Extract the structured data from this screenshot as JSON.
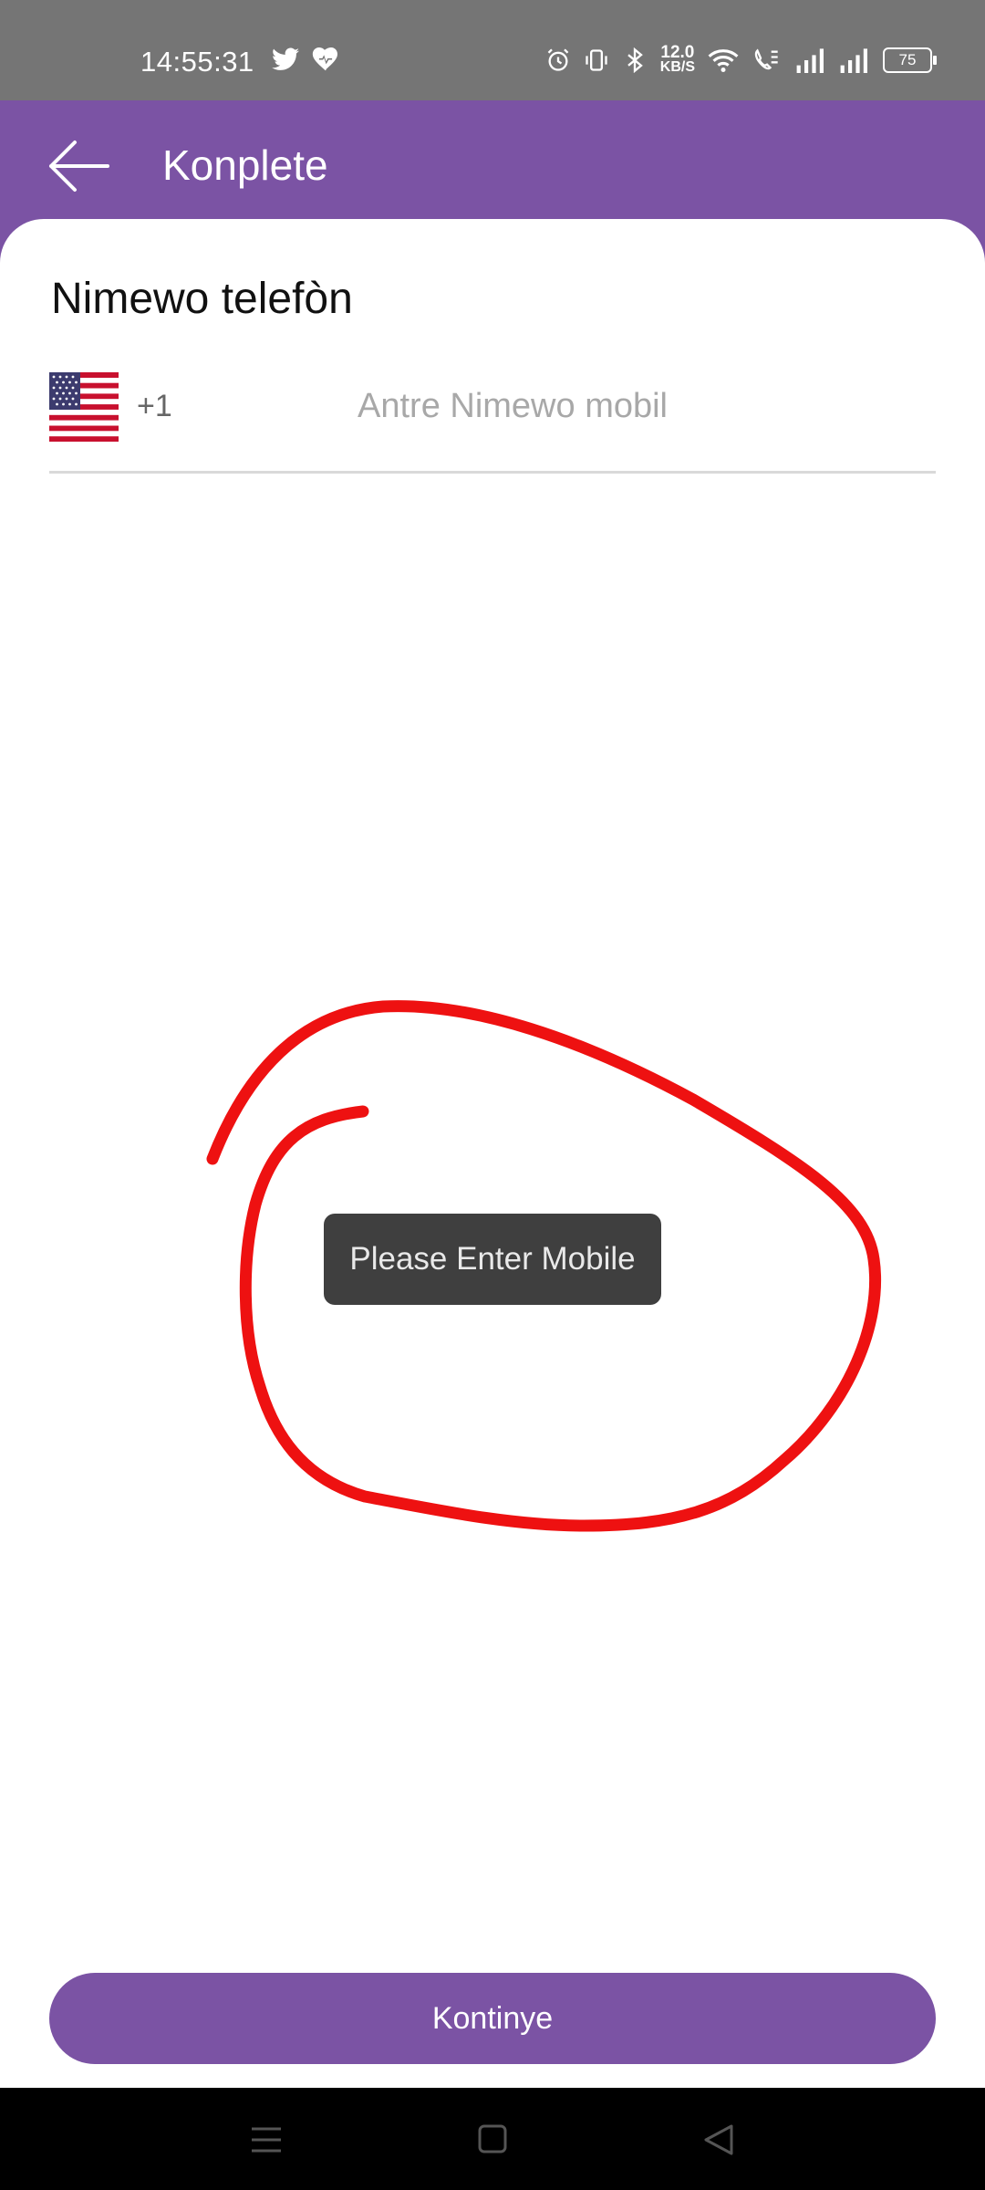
{
  "status_bar": {
    "time": "14:55:31",
    "left_icons": [
      "twitter-icon",
      "heart-icon"
    ],
    "net_speed_value": "12.0",
    "net_speed_unit": "KB/S",
    "right_icons": [
      "alarm-icon",
      "vibrate-icon",
      "bluetooth-icon",
      "wifi-icon",
      "volte-icon",
      "signal-icon",
      "signal-icon"
    ],
    "battery": "75"
  },
  "app_bar": {
    "back_icon": "arrow-left-icon",
    "title": "Konplete"
  },
  "form": {
    "section_title": "Nimewo telefòn",
    "country_flag": "us-flag-icon",
    "country_code": "+1",
    "phone_placeholder": "Antre Nimewo mobil",
    "phone_value": ""
  },
  "toast": {
    "message": "Please Enter Mobile"
  },
  "annotation": {
    "color": "#ee1111"
  },
  "actions": {
    "continue_label": "Kontinye"
  },
  "nav_bar": {
    "icons": [
      "menu-icon",
      "home-icon",
      "back-triangle-icon"
    ]
  },
  "colors": {
    "primary": "#7b53a4",
    "status_bar": "#757575",
    "toast_bg": "#3f3f3f"
  }
}
